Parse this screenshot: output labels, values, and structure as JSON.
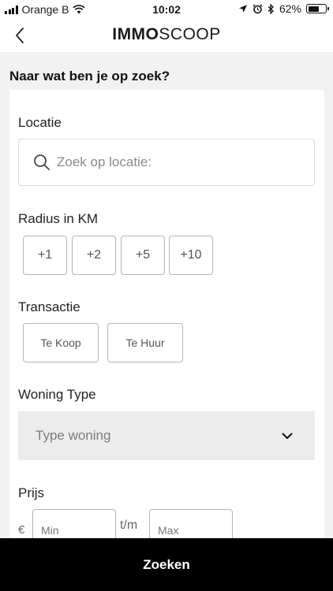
{
  "status_bar": {
    "carrier": "Orange B",
    "time": "10:02",
    "battery_percent": "62%",
    "battery_level": 0.62
  },
  "nav": {
    "back_icon": "chevron-left-icon",
    "logo_bold": "IMMO",
    "logo_light": "SCOOP"
  },
  "heading": "Naar wat ben je op zoek?",
  "location": {
    "label": "Locatie",
    "placeholder": "Zoek op locatie:",
    "value": ""
  },
  "radius": {
    "label": "Radius in KM",
    "options": [
      "+1",
      "+2",
      "+5",
      "+10"
    ]
  },
  "transaction": {
    "label": "Transactie",
    "options": [
      "Te Koop",
      "Te Huur"
    ]
  },
  "property_type": {
    "label": "Woning Type",
    "selected": "Type woning"
  },
  "price": {
    "label": "Prijs",
    "currency": "€",
    "min_placeholder": "Min",
    "separator": "t/m",
    "max_placeholder": "Max"
  },
  "submit": {
    "label": "Zoeken"
  },
  "colors": {
    "background": "#f2f2f2",
    "card": "#ffffff",
    "submit_bar": "#000000"
  }
}
